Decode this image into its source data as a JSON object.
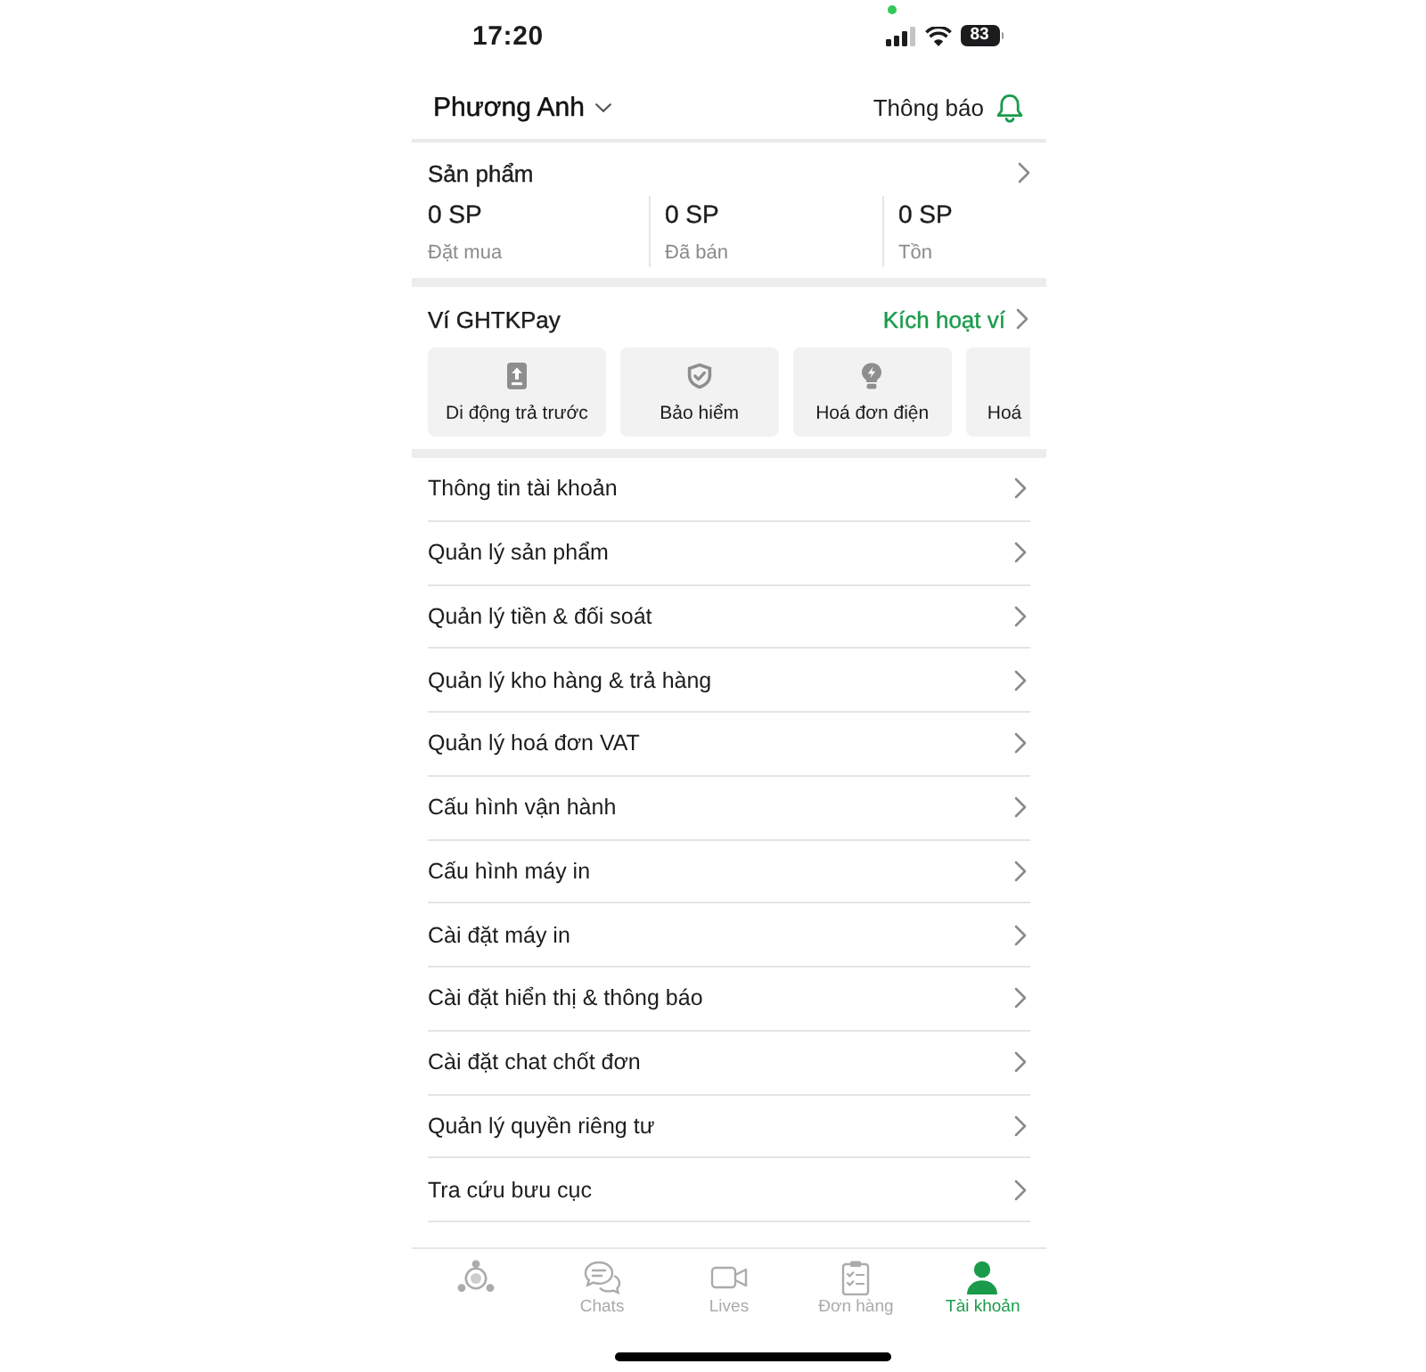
{
  "status_bar": {
    "time": "17:20",
    "battery": "83"
  },
  "header": {
    "account_name": "Phương Anh",
    "notifications_label": "Thông báo"
  },
  "products": {
    "title": "Sản phẩm",
    "stats": [
      {
        "value": "0 SP",
        "label": "Đặt mua"
      },
      {
        "value": "0 SP",
        "label": "Đã bán"
      },
      {
        "value": "0 SP",
        "label": "Tồn"
      }
    ]
  },
  "wallet": {
    "title": "Ví GHTKPay",
    "action": "Kích hoạt ví",
    "services": [
      {
        "kind": "topup",
        "label": "Di động trả trước"
      },
      {
        "kind": "insurance",
        "label": "Bảo hiểm"
      },
      {
        "kind": "electricity",
        "label": "Hoá đơn điện"
      },
      {
        "kind": "clipped",
        "label": "Hoá"
      }
    ]
  },
  "menu": [
    {
      "label": "Thông tin tài khoản"
    },
    {
      "label": "Quản lý sản phẩm"
    },
    {
      "label": "Quản lý tiền & đối soát"
    },
    {
      "label": "Quản lý kho hàng & trả hàng"
    },
    {
      "label": "Quản lý hoá đơn VAT"
    },
    {
      "label": "Cấu hình vận hành"
    },
    {
      "label": "Cấu hình máy in"
    },
    {
      "label": "Cài đặt máy in"
    },
    {
      "label": "Cài đặt hiển thị & thông báo"
    },
    {
      "label": "Cài đặt chat chốt đơn"
    },
    {
      "label": "Quản lý quyền riêng tư"
    },
    {
      "label": "Tra cứu bưu cục"
    }
  ],
  "tab_bar": [
    {
      "kind": "hub",
      "selected": false
    },
    {
      "kind": "chats",
      "label": "Chats",
      "selected": false
    },
    {
      "kind": "lives",
      "label": "Lives",
      "selected": false
    },
    {
      "kind": "orders",
      "label": "Đơn hàng",
      "selected": false
    },
    {
      "kind": "account",
      "label": "Tài khoản",
      "selected": true
    }
  ]
}
